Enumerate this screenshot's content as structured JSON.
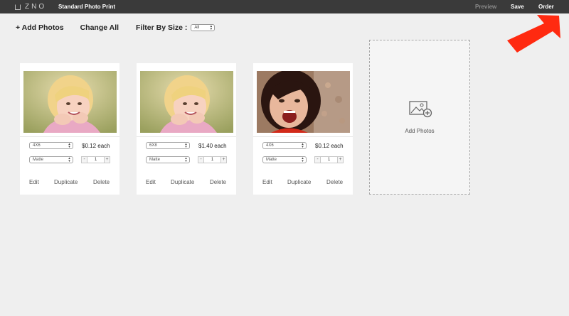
{
  "topbar": {
    "logo_text": "ZNO",
    "title": "Standard Photo Print",
    "preview_label": "Preview",
    "save_label": "Save",
    "order_label": "Order"
  },
  "toolbar": {
    "add_photos_label": "+ Add Photos",
    "change_all_label": "Change All",
    "filter_label": "Filter By Size :",
    "filter_value": "All"
  },
  "cards": [
    {
      "size": "4X6",
      "finish": "Matte",
      "price": "$0.12 each",
      "quantity": "1",
      "edit_label": "Edit",
      "duplicate_label": "Duplicate",
      "delete_label": "Delete"
    },
    {
      "size": "6X8",
      "finish": "Matte",
      "price": "$1.40 each",
      "quantity": "1",
      "edit_label": "Edit",
      "duplicate_label": "Duplicate",
      "delete_label": "Delete"
    },
    {
      "size": "4X6",
      "finish": "Matte",
      "price": "$0.12 each",
      "quantity": "1",
      "edit_label": "Edit",
      "duplicate_label": "Duplicate",
      "delete_label": "Delete"
    }
  ],
  "add_tile": {
    "label": "Add Photos"
  },
  "colors": {
    "topbar": "#3a3a3a",
    "background": "#efefef",
    "annotation_arrow": "#ff2a10"
  }
}
